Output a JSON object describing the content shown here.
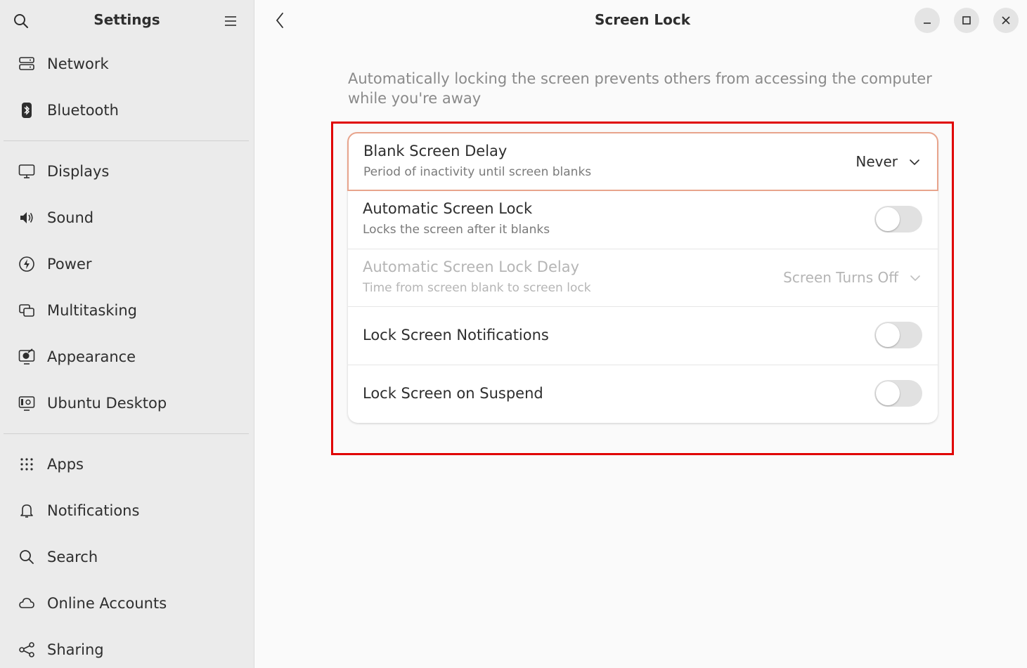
{
  "sidebar": {
    "title": "Settings",
    "groups": [
      [
        {
          "label": "Network",
          "icon": "network-icon"
        },
        {
          "label": "Bluetooth",
          "icon": "bluetooth-icon"
        }
      ],
      [
        {
          "label": "Displays",
          "icon": "display-icon"
        },
        {
          "label": "Sound",
          "icon": "speaker-icon"
        },
        {
          "label": "Power",
          "icon": "power-icon"
        },
        {
          "label": "Multitasking",
          "icon": "multitasking-icon"
        },
        {
          "label": "Appearance",
          "icon": "appearance-icon"
        },
        {
          "label": "Ubuntu Desktop",
          "icon": "ubuntu-desktop-icon"
        }
      ],
      [
        {
          "label": "Apps",
          "icon": "apps-grid-icon"
        },
        {
          "label": "Notifications",
          "icon": "bell-icon"
        },
        {
          "label": "Search",
          "icon": "search-icon"
        },
        {
          "label": "Online Accounts",
          "icon": "cloud-icon"
        },
        {
          "label": "Sharing",
          "icon": "share-icon"
        }
      ]
    ]
  },
  "header": {
    "title": "Screen Lock"
  },
  "main": {
    "description": "Automatically locking the screen prevents others from accessing the computer while you're away",
    "rows": [
      {
        "title": "Blank Screen Delay",
        "subtitle": "Period of inactivity until screen blanks",
        "value": "Never"
      },
      {
        "title": "Automatic Screen Lock",
        "subtitle": "Locks the screen after it blanks",
        "enabled": false
      },
      {
        "title": "Automatic Screen Lock Delay",
        "subtitle": "Time from screen blank to screen lock",
        "value": "Screen Turns Off"
      },
      {
        "title": "Lock Screen Notifications",
        "enabled": false
      },
      {
        "title": "Lock Screen on Suspend",
        "enabled": false
      }
    ]
  },
  "colors": {
    "highlight": "#e00000",
    "focus_ring": "#e8a48c"
  }
}
